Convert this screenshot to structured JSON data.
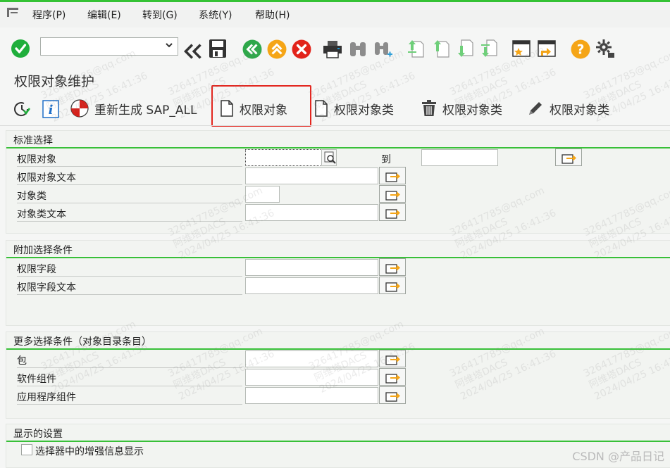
{
  "menu": {
    "items": [
      {
        "label": "程序(P)"
      },
      {
        "label": "编辑(E)"
      },
      {
        "label": "转到(G)"
      },
      {
        "label": "系统(Y)"
      },
      {
        "label": "帮助(H)"
      }
    ]
  },
  "toolbar": {
    "command_field_value": "",
    "icons": [
      "enter-check-icon",
      "expand-command-field-icon",
      "save-icon",
      "back-icon",
      "exit-icon",
      "cancel-icon",
      "print-icon",
      "find-icon",
      "find-next-icon",
      "first-page-icon",
      "previous-page-icon",
      "next-page-icon",
      "last-page-icon",
      "create-session-icon",
      "shortcut-icon",
      "help-icon",
      "customize-layout-icon"
    ]
  },
  "page": {
    "title": "权限对象维护"
  },
  "app_toolbar": {
    "regenerate_label": "重新生成 SAP_ALL",
    "auth_object_label": "权限对象",
    "object_class_label": "权限对象类",
    "delete_class_label": "权限对象类",
    "edit_class_label": "权限对象类"
  },
  "groups": {
    "standard": {
      "title": "标准选择",
      "rows": [
        {
          "label": "权限对象"
        },
        {
          "label": "权限对象文本"
        },
        {
          "label": "对象类"
        },
        {
          "label": "对象类文本"
        }
      ],
      "to_label": "到"
    },
    "additional": {
      "title": "附加选择条件",
      "rows": [
        {
          "label": "权限字段"
        },
        {
          "label": "权限字段文本"
        }
      ]
    },
    "more": {
      "title": "更多选择条件（对象目录条目）",
      "rows": [
        {
          "label": "包"
        },
        {
          "label": "软件组件"
        },
        {
          "label": "应用程序组件"
        }
      ]
    },
    "display": {
      "title": "显示的设置",
      "checkbox_label": "选择器中的增强信息显示",
      "checkbox_checked": false
    }
  },
  "watermark": {
    "line1": "326417785@qq.com",
    "line2": "阿维塔DACS",
    "line3": "2024/04/25 16:41:36"
  },
  "footer": {
    "brand": "CSDN @产品日记"
  },
  "colors": {
    "accent_green": "#34c234",
    "highlight_red": "#e3261f",
    "check_green": "#1fae3b",
    "nav_green": "#2ea84a",
    "nav_orange": "#f5a516",
    "nav_red": "#e2231a"
  }
}
